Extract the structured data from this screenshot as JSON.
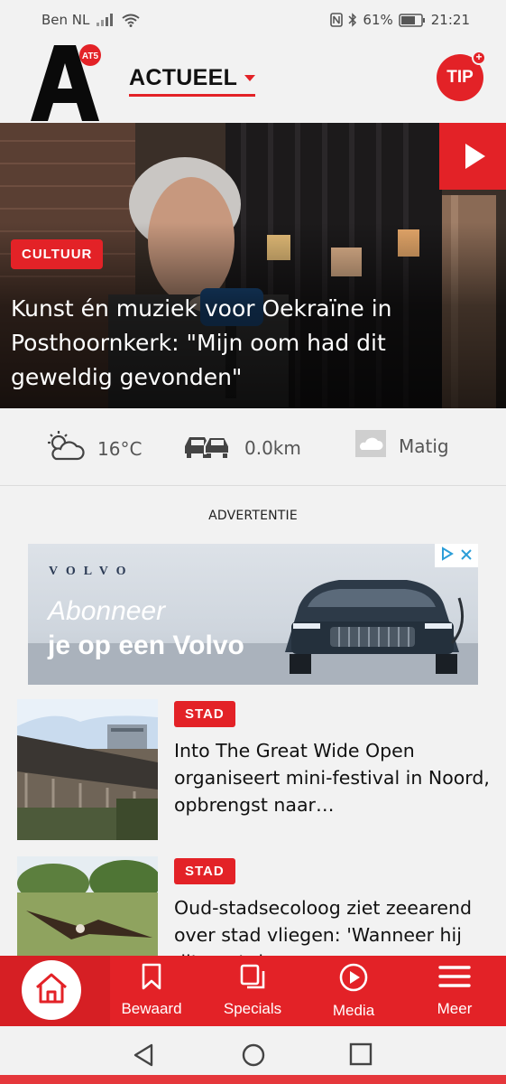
{
  "status_bar": {
    "carrier": "Ben NL",
    "battery": "61%",
    "time": "21:21"
  },
  "header": {
    "logo_text": "A",
    "logo_badge": "AT5",
    "section": "ACTUEEL",
    "tip_label": "TIP",
    "tip_plus": "+"
  },
  "hero": {
    "category": "CULTUUR",
    "title": "Kunst én muziek voor Oekraïne in Posthoornkerk: \"Mijn oom had dit geweldig gevonden\"",
    "play_icon": "play-icon"
  },
  "info": {
    "weather": "16°C",
    "traffic": "0.0km",
    "air": "Matig"
  },
  "ad": {
    "label": "ADVERTENTIE",
    "brand": "VOLVO",
    "line1": "Abonneer",
    "line2": "je op een Volvo"
  },
  "articles": [
    {
      "category": "STAD",
      "title": "Into The Great Wide Open organiseert mini-festival in Noord, opbrengst naar…"
    },
    {
      "category": "STAD",
      "title": "Oud-stadsecoloog ziet zeearend over stad vliegen: 'Wanneer hij dit gaat doen…"
    }
  ],
  "bottom_nav": {
    "items": [
      {
        "label": "Bewaard",
        "icon": "bookmark-icon"
      },
      {
        "label": "Specials",
        "icon": "stack-icon"
      },
      {
        "label": "Media",
        "icon": "play-circle-icon"
      },
      {
        "label": "Meer",
        "icon": "menu-icon"
      }
    ],
    "home_icon": "home-icon"
  },
  "colors": {
    "accent": "#e32227",
    "background": "#f2f2f2"
  }
}
